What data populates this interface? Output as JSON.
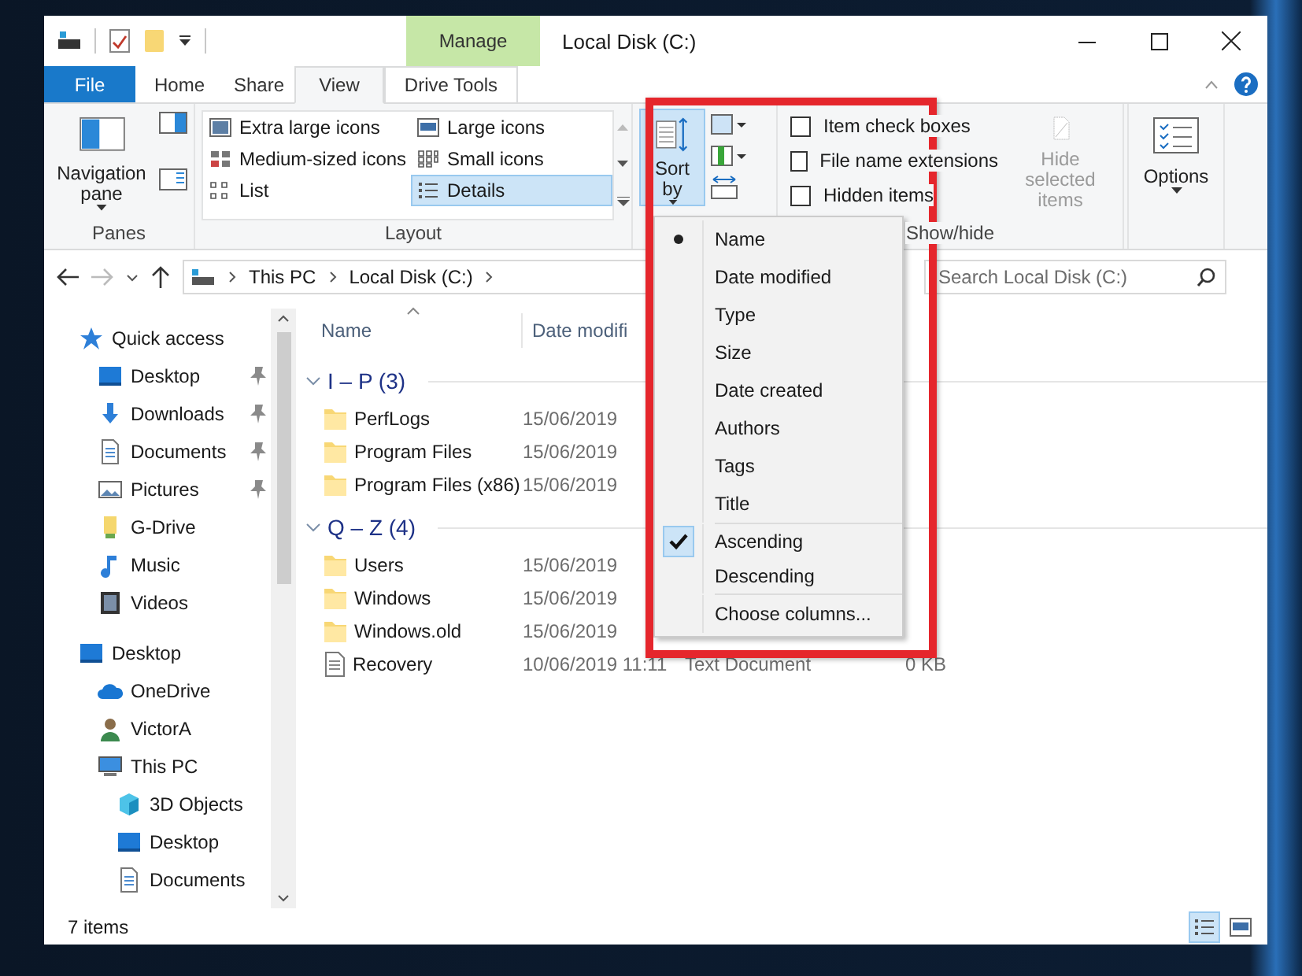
{
  "window": {
    "title": "Local Disk (C:)",
    "contextual_tab": "Manage"
  },
  "ribbon_tabs": [
    {
      "label": "File",
      "kind": "file",
      "selected": false
    },
    {
      "label": "Home",
      "kind": "tab",
      "selected": false
    },
    {
      "label": "Share",
      "kind": "tab",
      "selected": false
    },
    {
      "label": "View",
      "kind": "tab",
      "selected": true
    },
    {
      "label": "Drive Tools",
      "kind": "contextual",
      "selected": false
    }
  ],
  "ribbon_groups": [
    {
      "kind": "panes",
      "label": "Panes",
      "button": "Navigation pane"
    },
    {
      "kind": "layout",
      "label": "Layout",
      "options": [
        {
          "label": "Extra large icons",
          "selected": false
        },
        {
          "label": "Large icons",
          "selected": false
        },
        {
          "label": "Medium-sized icons",
          "selected": false
        },
        {
          "label": "Small icons",
          "selected": false
        },
        {
          "label": "List",
          "selected": false
        },
        {
          "label": "Details",
          "selected": true
        }
      ]
    },
    {
      "kind": "current_view",
      "button": "Sort by",
      "expanded": true
    },
    {
      "kind": "show_hide",
      "label": "Show/hide",
      "checkboxes": [
        {
          "label": "Item check boxes",
          "checked": false
        },
        {
          "label": "File name extensions",
          "checked": false
        },
        {
          "label": "Hidden items",
          "checked": false
        }
      ],
      "button": "Hide selected items",
      "disabled": true
    },
    {
      "kind": "options",
      "button": "Options"
    }
  ],
  "address": {
    "crumbs": [
      "This PC",
      "Local Disk (C:)"
    ]
  },
  "search": {
    "placeholder": "Search Local Disk (C:)"
  },
  "nav_pane": {
    "items": [
      {
        "label": "Quick access",
        "kind": "star",
        "children": [
          {
            "label": "Desktop",
            "kind": "desktop",
            "pinned": true
          },
          {
            "label": "Downloads",
            "kind": "download",
            "pinned": true
          },
          {
            "label": "Documents",
            "kind": "document",
            "pinned": true
          },
          {
            "label": "Pictures",
            "kind": "picture",
            "pinned": true
          },
          {
            "label": "G-Drive",
            "kind": "drive",
            "pinned": false
          },
          {
            "label": "Music",
            "kind": "music",
            "pinned": false
          },
          {
            "label": "Videos",
            "kind": "video",
            "pinned": false
          }
        ]
      },
      {
        "label": "Desktop",
        "kind": "desktop",
        "children": [
          {
            "label": "OneDrive",
            "kind": "cloud"
          },
          {
            "label": "VictorA",
            "kind": "user"
          },
          {
            "label": "This PC",
            "kind": "pc",
            "children": [
              {
                "label": "3D Objects",
                "kind": "cube"
              },
              {
                "label": "Desktop",
                "kind": "desktop"
              },
              {
                "label": "Documents",
                "kind": "document"
              }
            ]
          }
        ]
      }
    ]
  },
  "file_list": {
    "columns": [
      {
        "label": "Name",
        "sorted": true
      },
      {
        "label": "Date modifi",
        "sorted": false
      }
    ],
    "groups": [
      {
        "label": "I – P (3)",
        "expanded": true,
        "rows": [
          {
            "kind": "folder",
            "name": "PerfLogs",
            "date": "15/06/2019"
          },
          {
            "kind": "folder",
            "name": "Program Files",
            "date": "15/06/2019"
          },
          {
            "kind": "folder",
            "name": "Program Files (x86)",
            "date": "15/06/2019"
          }
        ]
      },
      {
        "label": "Q – Z (4)",
        "expanded": true,
        "rows": [
          {
            "kind": "folder",
            "name": "Users",
            "date": "15/06/2019"
          },
          {
            "kind": "folder",
            "name": "Windows",
            "date": "15/06/2019"
          },
          {
            "kind": "folder",
            "name": "Windows.old",
            "date": "15/06/2019"
          },
          {
            "kind": "file",
            "name": "Recovery",
            "date": "10/06/2019 11:11",
            "type": "Text Document",
            "size": "0 KB"
          }
        ]
      }
    ]
  },
  "sort_menu": {
    "items": [
      {
        "label": "Name",
        "kind": "field",
        "selected": true
      },
      {
        "label": "Date modified",
        "kind": "field",
        "selected": false
      },
      {
        "label": "Type",
        "kind": "field",
        "selected": false
      },
      {
        "label": "Size",
        "kind": "field",
        "selected": false
      },
      {
        "label": "Date created",
        "kind": "field",
        "selected": false
      },
      {
        "label": "Authors",
        "kind": "field",
        "selected": false
      },
      {
        "label": "Tags",
        "kind": "field",
        "selected": false
      },
      {
        "label": "Title",
        "kind": "field",
        "selected": false
      },
      {
        "label": "Ascending",
        "kind": "order",
        "selected": true
      },
      {
        "label": "Descending",
        "kind": "order",
        "selected": false
      },
      {
        "label": "Choose columns...",
        "kind": "action"
      }
    ]
  },
  "status_bar": {
    "item_count": "7 items",
    "views": [
      {
        "kind": "details",
        "selected": true
      },
      {
        "kind": "large_icons",
        "selected": false
      }
    ]
  }
}
